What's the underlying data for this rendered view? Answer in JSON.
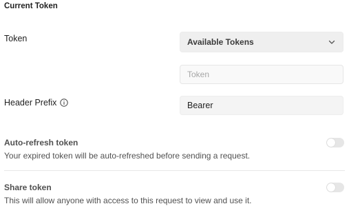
{
  "section": {
    "title": "Current Token"
  },
  "token": {
    "label": "Token",
    "dropdown_value": "Available Tokens",
    "input_placeholder": "Token",
    "input_value": ""
  },
  "header_prefix": {
    "label": "Header Prefix",
    "value": "Bearer"
  },
  "auto_refresh": {
    "title": "Auto-refresh token",
    "description": "Your expired token will be auto-refreshed before sending a request.",
    "enabled": false
  },
  "share_token": {
    "title": "Share token",
    "description": "This will allow anyone with access to this request to view and use it.",
    "enabled": false
  },
  "icons": {
    "info": "info-icon",
    "chevron": "chevron-down-icon"
  },
  "colors": {
    "text": "#212121",
    "muted_text": "#505050",
    "field_bg": "#f4f4f4",
    "toggle_off": "#e6e6e6"
  }
}
